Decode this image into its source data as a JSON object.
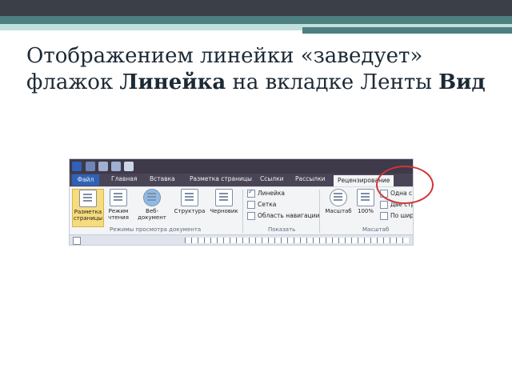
{
  "slide": {
    "title_part1": "Отображением линейки «заведует» флажок ",
    "title_bold1": "Линейка",
    "title_part2": " на вкладке Ленты ",
    "title_bold2": "Вид"
  },
  "ribbon": {
    "tabs": [
      "Файл",
      "Главная",
      "Вставка",
      "Разметка страницы",
      "Ссылки",
      "Рассылки",
      "Рецензирование"
    ],
    "buttons": [
      "Разметка страницы",
      "Режим чтения",
      "Веб-документ",
      "Структура",
      "Черновик"
    ],
    "group_view_modes": "Режимы просмотра документа",
    "show_checks": [
      "Линейка",
      "Сетка",
      "Область навигации"
    ],
    "group_show": "Показать",
    "zoom_buttons": [
      "Масштаб",
      "100%"
    ],
    "zoom_items": [
      "Одна с",
      "Две стр",
      "По шир"
    ],
    "group_zoom": "Масштаб"
  },
  "colors": {
    "accent_circle": "#d23434",
    "selected_button": "#f6dc7d",
    "file_tab": "#2f61b8"
  }
}
